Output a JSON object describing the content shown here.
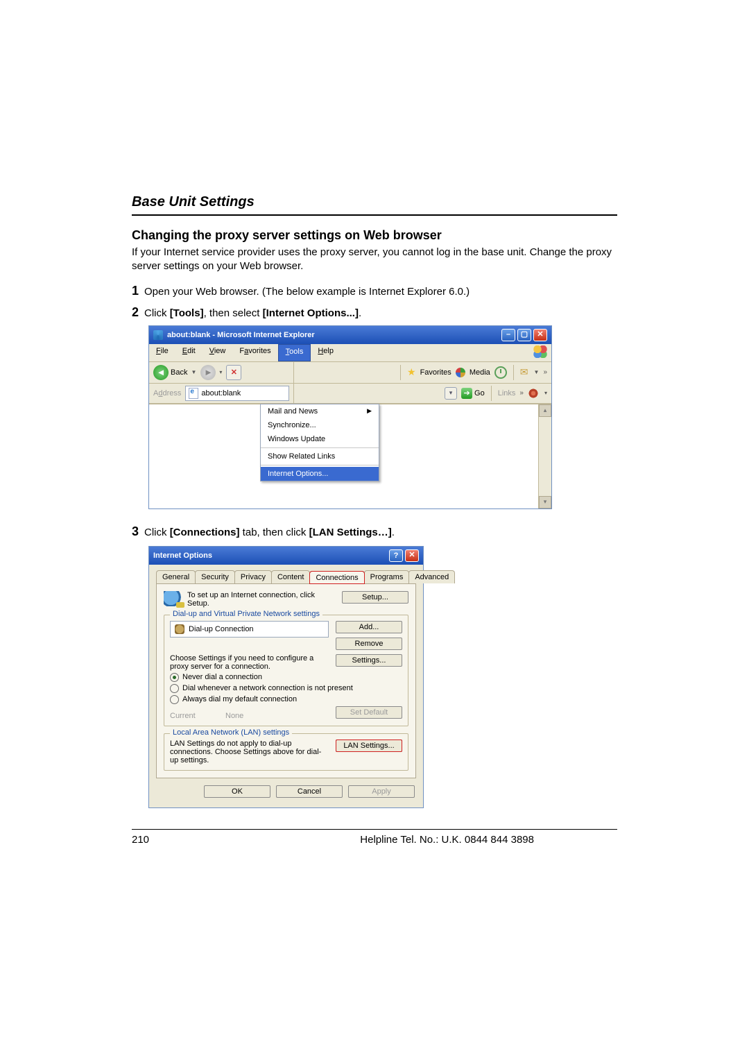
{
  "section_title": "Base Unit Settings",
  "heading": "Changing the proxy server settings on Web browser",
  "intro": "If your Internet service provider uses the proxy server, you cannot log in the base unit. Change the proxy server settings on your Web browser.",
  "steps": {
    "s1_num": "1",
    "s1_text": "Open your Web browser. (The below example is Internet Explorer 6.0.)",
    "s2_num": "2",
    "s2_pre": "Click ",
    "s2_bold1": "[Tools]",
    "s2_mid": ", then select ",
    "s2_bold2": "[Internet Options...]",
    "s2_post": ".",
    "s3_num": "3",
    "s3_pre": "Click ",
    "s3_bold1": "[Connections]",
    "s3_mid": " tab, then click ",
    "s3_bold2": "[LAN Settings…]",
    "s3_post": "."
  },
  "ie": {
    "title": "about:blank - Microsoft Internet Explorer",
    "menu": {
      "file": "File",
      "edit": "Edit",
      "view": "View",
      "favorites": "Favorites",
      "tools": "Tools",
      "help": "Help"
    },
    "toolbar": {
      "back": "Back",
      "favorites": "Favorites",
      "media": "Media"
    },
    "address_label": "Address",
    "address_value": "about:blank",
    "go": "Go",
    "links": "Links",
    "tools_menu": {
      "mail": "Mail and News",
      "sync": "Synchronize...",
      "wu": "Windows Update",
      "related": "Show Related Links",
      "iopts": "Internet Options..."
    }
  },
  "dlg": {
    "title": "Internet Options",
    "tabs": {
      "general": "General",
      "security": "Security",
      "privacy": "Privacy",
      "content": "Content",
      "connections": "Connections",
      "programs": "Programs",
      "advanced": "Advanced"
    },
    "setup_text": "To set up an Internet connection, click Setup.",
    "setup_btn": "Setup...",
    "dialup_legend": "Dial-up and Virtual Private Network settings",
    "dialup_item": "Dial-up Connection",
    "add_btn": "Add...",
    "remove_btn": "Remove",
    "proxy_hint": "Choose Settings if you need to configure a proxy server for a connection.",
    "settings_btn": "Settings...",
    "r1": "Never dial a connection",
    "r2": "Dial whenever a network connection is not present",
    "r3": "Always dial my default connection",
    "current_lbl": "Current",
    "current_val": "None",
    "setdefault_btn": "Set Default",
    "lan_legend": "Local Area Network (LAN) settings",
    "lan_hint": "LAN Settings do not apply to dial-up connections. Choose Settings above for dial-up settings.",
    "lan_btn": "LAN Settings...",
    "ok": "OK",
    "cancel": "Cancel",
    "apply": "Apply"
  },
  "footer": {
    "page": "210",
    "help": "Helpline Tel. No.: U.K. 0844 844 3898"
  }
}
